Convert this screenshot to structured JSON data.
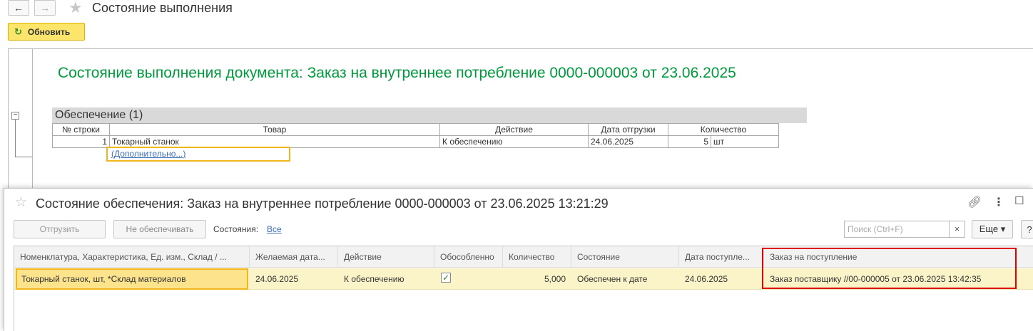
{
  "toolbar": {
    "back_icon": "arrow-left-icon",
    "forward_icon": "arrow-right-icon",
    "favorite_icon": "star-icon",
    "title": "Состояние выполнения",
    "refresh_label": "Обновить",
    "refresh_icon": "refresh-icon"
  },
  "report": {
    "title": "Состояние выполнения документа: Заказ на внутреннее потребление 0000-000003 от 23.06.2025",
    "section_title": "Обеспечение (1)",
    "columns": [
      "№ строки",
      "Товар",
      "Действие",
      "Дата отгрузки",
      "Количество"
    ],
    "rows": [
      {
        "line": "1",
        "product": "Токарный станок",
        "action": "К обеспечению",
        "ship_date": "24.06.2025",
        "qty": "5",
        "unit": "шт"
      }
    ],
    "more_link": "(Дополнительно...)"
  },
  "form": {
    "favorite_icon": "star-icon",
    "title": "Состояние обеспечения: Заказ на внутреннее потребление 0000-000003 от 23.06.2025 13:21:29",
    "link_icon": "link-icon",
    "menu_icon": "more-vertical-icon",
    "maximize_icon": "maximize-icon",
    "ship_button": "Отгрузить",
    "no_provision_button": "Не обеспечивать",
    "states_label": "Состояния:",
    "states_value": "Все",
    "search_placeholder": "Поиск (Ctrl+F)",
    "search_clear": "×",
    "more_button": "Еще ▾",
    "help_button": "?",
    "columns": {
      "item": "Номенклатура, Характеристика, Ед. изм., Склад / ...",
      "desired_date": "Желаемая дата...",
      "action": "Действие",
      "separate": "Обособленно",
      "quantity": "Количество",
      "state": "Состояние",
      "receipt_date": "Дата поступле...",
      "receipt_order": "Заказ на поступление"
    },
    "rows": [
      {
        "item": "Токарный станок, шт, *Склад материалов",
        "desired_date": "24.06.2025",
        "action": "К обеспечению",
        "separate": true,
        "quantity": "5,000",
        "state": "Обеспечен к дате",
        "receipt_date": "24.06.2025",
        "receipt_order": "Заказ поставщику //00-000005 от 23.06.2025 13:42:35"
      }
    ]
  },
  "colors": {
    "report_title": "#009a3e",
    "refresh_button": "#fde46a",
    "selected_row": "#fbf4c8",
    "highlight_frame": "#e00000",
    "link": "#3b6eb8"
  }
}
